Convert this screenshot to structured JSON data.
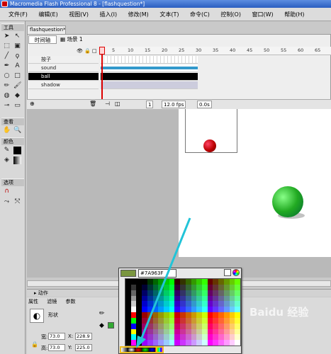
{
  "window": {
    "title": "Macromedia Flash Professional 8 - [flashquestion*]"
  },
  "menu": [
    "文件(F)",
    "编辑(E)",
    "视图(V)",
    "插入(I)",
    "修改(M)",
    "文本(T)",
    "命令(C)",
    "控制(O)",
    "窗口(W)",
    "帮助(H)"
  ],
  "toolbox": {
    "header_tools": "工具",
    "header_view": "查看",
    "header_colors": "颜色",
    "header_options": "选项"
  },
  "document": {
    "tab": "flashquestion*",
    "scene": "场景 1"
  },
  "timeline": {
    "tab": "时间轴",
    "ruler_ticks": [
      "1",
      "5",
      "10",
      "15",
      "20",
      "25",
      "30",
      "35",
      "40",
      "45",
      "50",
      "55",
      "60",
      "65"
    ],
    "layers": [
      {
        "name": "按子",
        "selected": false
      },
      {
        "name": "sound",
        "selected": false
      },
      {
        "name": "ball",
        "selected": true
      },
      {
        "name": "shadow",
        "selected": false
      }
    ],
    "current_frame": "1",
    "fps": "12.0 fps",
    "elapsed": "0.0s"
  },
  "panels": {
    "actions": "动作",
    "props_tabs": [
      "属性",
      "滤镜",
      "参数"
    ],
    "shape_label": "形状"
  },
  "properties": {
    "w_label": "宽:",
    "w": "73.0",
    "x_label": "X:",
    "x": "228.9",
    "h_label": "高:",
    "h": "73.0",
    "y_label": "Y:",
    "y": "225.0"
  },
  "color_picker": {
    "hex": "#7A963F",
    "current_color": "#7a963f"
  },
  "watermark": "Baidu 经验",
  "colors": {
    "selection": "#000000",
    "playhead": "#dd0000",
    "arrow": "#22c4d8"
  }
}
